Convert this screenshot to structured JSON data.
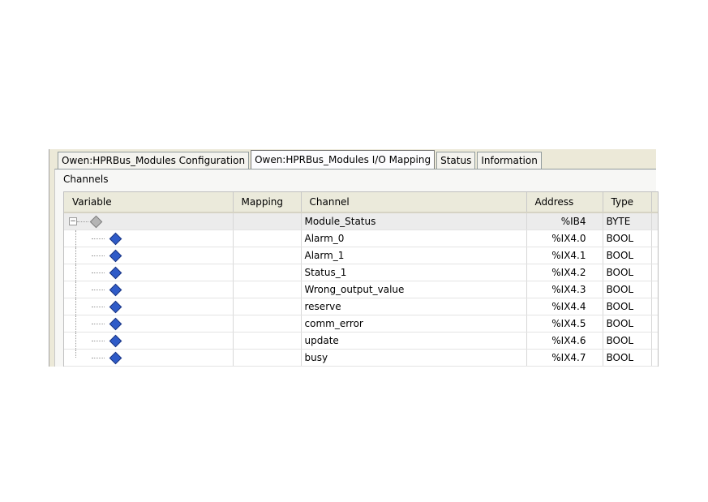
{
  "tabs": [
    {
      "label": "Owen:HPRBus_Modules Configuration",
      "active": false
    },
    {
      "label": "Owen:HPRBus_Modules I/O Mapping",
      "active": true
    },
    {
      "label": "Status",
      "active": false
    },
    {
      "label": "Information",
      "active": false
    }
  ],
  "group_label": "Channels",
  "columns": {
    "variable": "Variable",
    "mapping": "Mapping",
    "channel": "Channel",
    "address": "Address",
    "type": "Type"
  },
  "rows": [
    {
      "channel": "Module_Status",
      "address": "%IB4",
      "type": "BYTE",
      "icon": "grey-variable-icon",
      "root": true,
      "expander": "−"
    },
    {
      "channel": "Alarm_0",
      "address": "%IX4.0",
      "type": "BOOL",
      "icon": "blue-variable-icon"
    },
    {
      "channel": "Alarm_1",
      "address": "%IX4.1",
      "type": "BOOL",
      "icon": "blue-variable-icon"
    },
    {
      "channel": "Status_1",
      "address": "%IX4.2",
      "type": "BOOL",
      "icon": "blue-variable-icon"
    },
    {
      "channel": "Wrong_output_value",
      "address": "%IX4.3",
      "type": "BOOL",
      "icon": "blue-variable-icon"
    },
    {
      "channel": "reserve",
      "address": "%IX4.4",
      "type": "BOOL",
      "icon": "blue-variable-icon"
    },
    {
      "channel": "comm_error",
      "address": "%IX4.5",
      "type": "BOOL",
      "icon": "blue-variable-icon"
    },
    {
      "channel": "update",
      "address": "%IX4.6",
      "type": "BOOL",
      "icon": "blue-variable-icon"
    },
    {
      "channel": "busy",
      "address": "%IX4.7",
      "type": "BOOL",
      "icon": "blue-variable-icon"
    }
  ]
}
